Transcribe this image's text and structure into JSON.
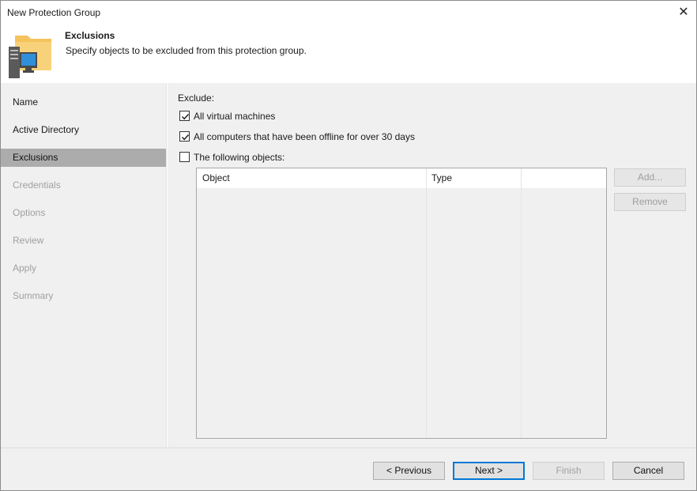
{
  "window": {
    "title": "New Protection Group"
  },
  "header": {
    "title": "Exclusions",
    "subtitle": "Specify objects to be excluded from this protection group."
  },
  "steps": [
    {
      "label": "Name",
      "state": "enabled"
    },
    {
      "label": "Active Directory",
      "state": "enabled"
    },
    {
      "label": "Exclusions",
      "state": "active"
    },
    {
      "label": "Credentials",
      "state": "disabled"
    },
    {
      "label": "Options",
      "state": "disabled"
    },
    {
      "label": "Review",
      "state": "disabled"
    },
    {
      "label": "Apply",
      "state": "disabled"
    },
    {
      "label": "Summary",
      "state": "disabled"
    }
  ],
  "exclude": {
    "label": "Exclude:",
    "options": [
      {
        "label": "All virtual machines",
        "checked": true
      },
      {
        "label": "All computers that have been offline for over 30 days",
        "checked": true
      },
      {
        "label": "The following objects:",
        "checked": false
      }
    ]
  },
  "table": {
    "columns": [
      "Object",
      "Type"
    ],
    "rows": []
  },
  "side_buttons": {
    "add": "Add...",
    "remove": "Remove"
  },
  "footer": {
    "previous": "< Previous",
    "next": "Next >",
    "finish": "Finish",
    "cancel": "Cancel"
  }
}
